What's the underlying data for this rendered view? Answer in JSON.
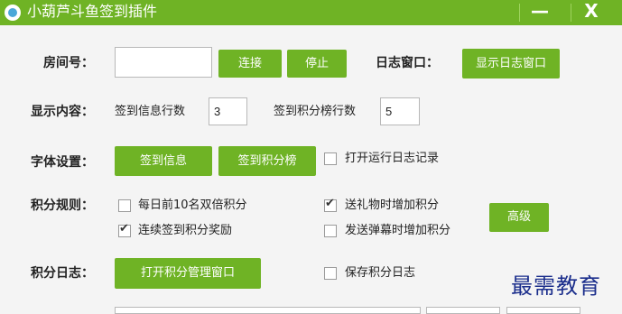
{
  "window": {
    "title": "小葫芦斗鱼签到插件",
    "minimize_label": "—",
    "close_label": "X"
  },
  "room": {
    "label": "房间号：",
    "value": "",
    "connect_label": "连接",
    "stop_label": "停止"
  },
  "log_window": {
    "label": "日志窗口：",
    "show_label": "显示日志窗口"
  },
  "display": {
    "label": "显示内容：",
    "signin_rows_label": "签到信息行数",
    "signin_rows_value": "3",
    "rank_rows_label": "签到积分榜行数",
    "rank_rows_value": "5"
  },
  "font": {
    "label": "字体设置：",
    "signin_info_label": "签到信息",
    "signin_rank_label": "签到积分榜",
    "run_log": {
      "label": "打开运行日志记录",
      "checked": false
    }
  },
  "rules": {
    "label": "积分规则：",
    "daily_top10": {
      "label": "每日前10名双倍积分",
      "checked": false
    },
    "gift_bonus": {
      "label": "送礼物时增加积分",
      "checked": true
    },
    "streak_reward": {
      "label": "连续签到积分奖励",
      "checked": true
    },
    "danmaku_bonus": {
      "label": "发送弹幕时增加积分",
      "checked": false
    },
    "advanced_label": "高级"
  },
  "points_log": {
    "label": "积分日志：",
    "open_manager_label": "打开积分管理窗口",
    "save_log": {
      "label": "保存积分日志",
      "checked": false
    }
  },
  "watermark": "最需教育"
}
